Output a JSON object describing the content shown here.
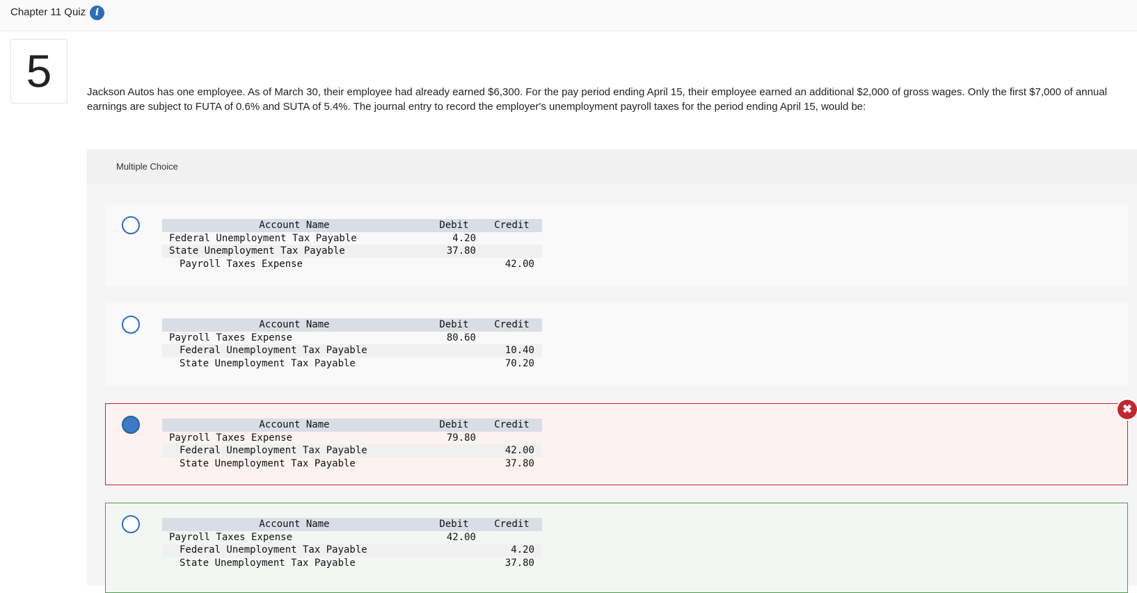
{
  "header": {
    "title": "Chapter 11 Quiz",
    "info_icon": "info-icon"
  },
  "question": {
    "number": "5",
    "text": "Jackson Autos has one employee. As of March 30, their employee had already earned $6,300. For the pay period ending April 15, their employee earned an additional $2,000 of gross wages. Only the first $7,000 of annual earnings are subject to FUTA of 0.6% and SUTA of 5.4%. The journal entry to record the employer's unemployment payroll taxes for the period ending April 15, would be:"
  },
  "answer_section": {
    "label": "Multiple Choice"
  },
  "table_headers": {
    "account": "Account Name",
    "debit": "Debit",
    "credit": "Credit"
  },
  "options": [
    {
      "state": "default",
      "selected": false,
      "rows": [
        {
          "account": "Federal Unemployment Tax Payable",
          "debit": "4.20",
          "credit": ""
        },
        {
          "account": "State Unemployment Tax Payable",
          "debit": "37.80",
          "credit": ""
        },
        {
          "account": "Payroll Taxes Expense",
          "debit": "",
          "credit": "42.00"
        }
      ]
    },
    {
      "state": "default",
      "selected": false,
      "rows": [
        {
          "account": "Payroll Taxes Expense",
          "debit": "80.60",
          "credit": ""
        },
        {
          "account": "Federal Unemployment Tax Payable",
          "debit": "",
          "credit": "10.40"
        },
        {
          "account": "State Unemployment Tax Payable",
          "debit": "",
          "credit": "70.20"
        }
      ]
    },
    {
      "state": "incorrect",
      "selected": true,
      "rows": [
        {
          "account": "Payroll Taxes Expense",
          "debit": "79.80",
          "credit": ""
        },
        {
          "account": "Federal Unemployment Tax Payable",
          "debit": "",
          "credit": "42.00"
        },
        {
          "account": "State Unemployment Tax Payable",
          "debit": "",
          "credit": "37.80"
        }
      ]
    },
    {
      "state": "correct",
      "selected": false,
      "rows": [
        {
          "account": "Payroll Taxes Expense",
          "debit": "42.00",
          "credit": ""
        },
        {
          "account": "Federal Unemployment Tax Payable",
          "debit": "",
          "credit": "4.20"
        },
        {
          "account": "State Unemployment Tax Payable",
          "debit": "",
          "credit": "37.80"
        }
      ]
    }
  ],
  "feedback": {
    "incorrect_icon": "close-icon",
    "incorrect_glyph": "✖"
  },
  "colors": {
    "accent": "#2a6ebb",
    "incorrect": "#c0282d",
    "correct": "#4b9a4b",
    "table_header": "#d9dde6"
  }
}
